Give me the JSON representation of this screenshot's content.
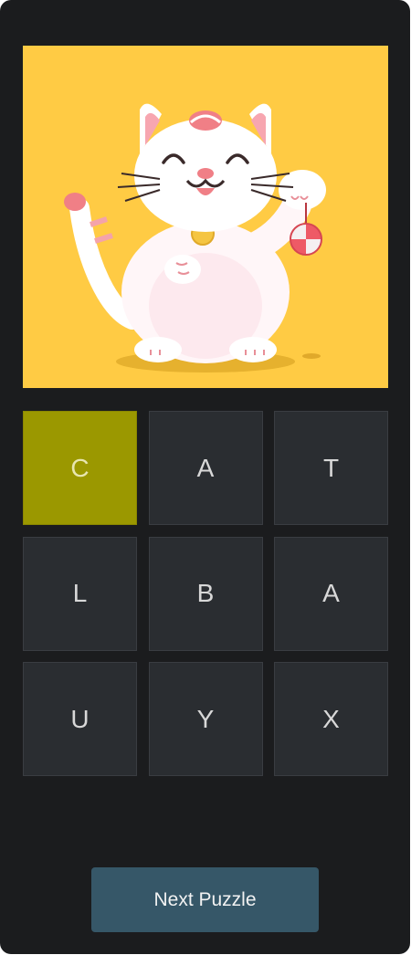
{
  "puzzle_image": {
    "icon": "maneki-neko-cat-illustration",
    "background_color": "#ffcb44"
  },
  "letter_grid": {
    "tiles": [
      {
        "letter": "C",
        "selected": true
      },
      {
        "letter": "A",
        "selected": false
      },
      {
        "letter": "T",
        "selected": false
      },
      {
        "letter": "L",
        "selected": false
      },
      {
        "letter": "B",
        "selected": false
      },
      {
        "letter": "A",
        "selected": false
      },
      {
        "letter": "U",
        "selected": false
      },
      {
        "letter": "Y",
        "selected": false
      },
      {
        "letter": "X",
        "selected": false
      }
    ],
    "selected_color": "#9b9800",
    "tile_color": "#2a2d31"
  },
  "actions": {
    "next_label": "Next Puzzle",
    "button_color": "#365768"
  }
}
